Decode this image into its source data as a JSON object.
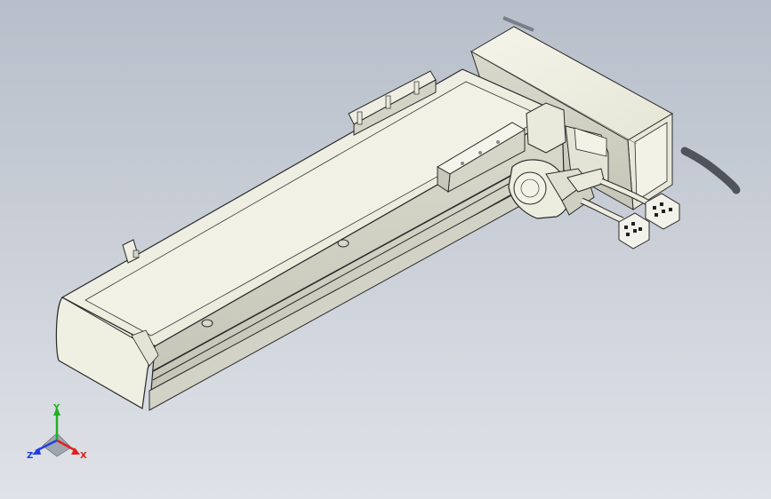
{
  "model": {
    "name": "linear-actuator-assembly",
    "body_color": "#efefe2",
    "edge_color": "#2a2a2a",
    "shadow_color": "#5a5e66"
  },
  "triad": {
    "x_label": "X",
    "y_label": "Y",
    "z_label": "Z",
    "x_color": "#e02020",
    "y_color": "#20b020",
    "z_color": "#2040e0"
  },
  "background": {
    "top_color": "#b8bfca",
    "bottom_color": "#dfe2e8"
  }
}
